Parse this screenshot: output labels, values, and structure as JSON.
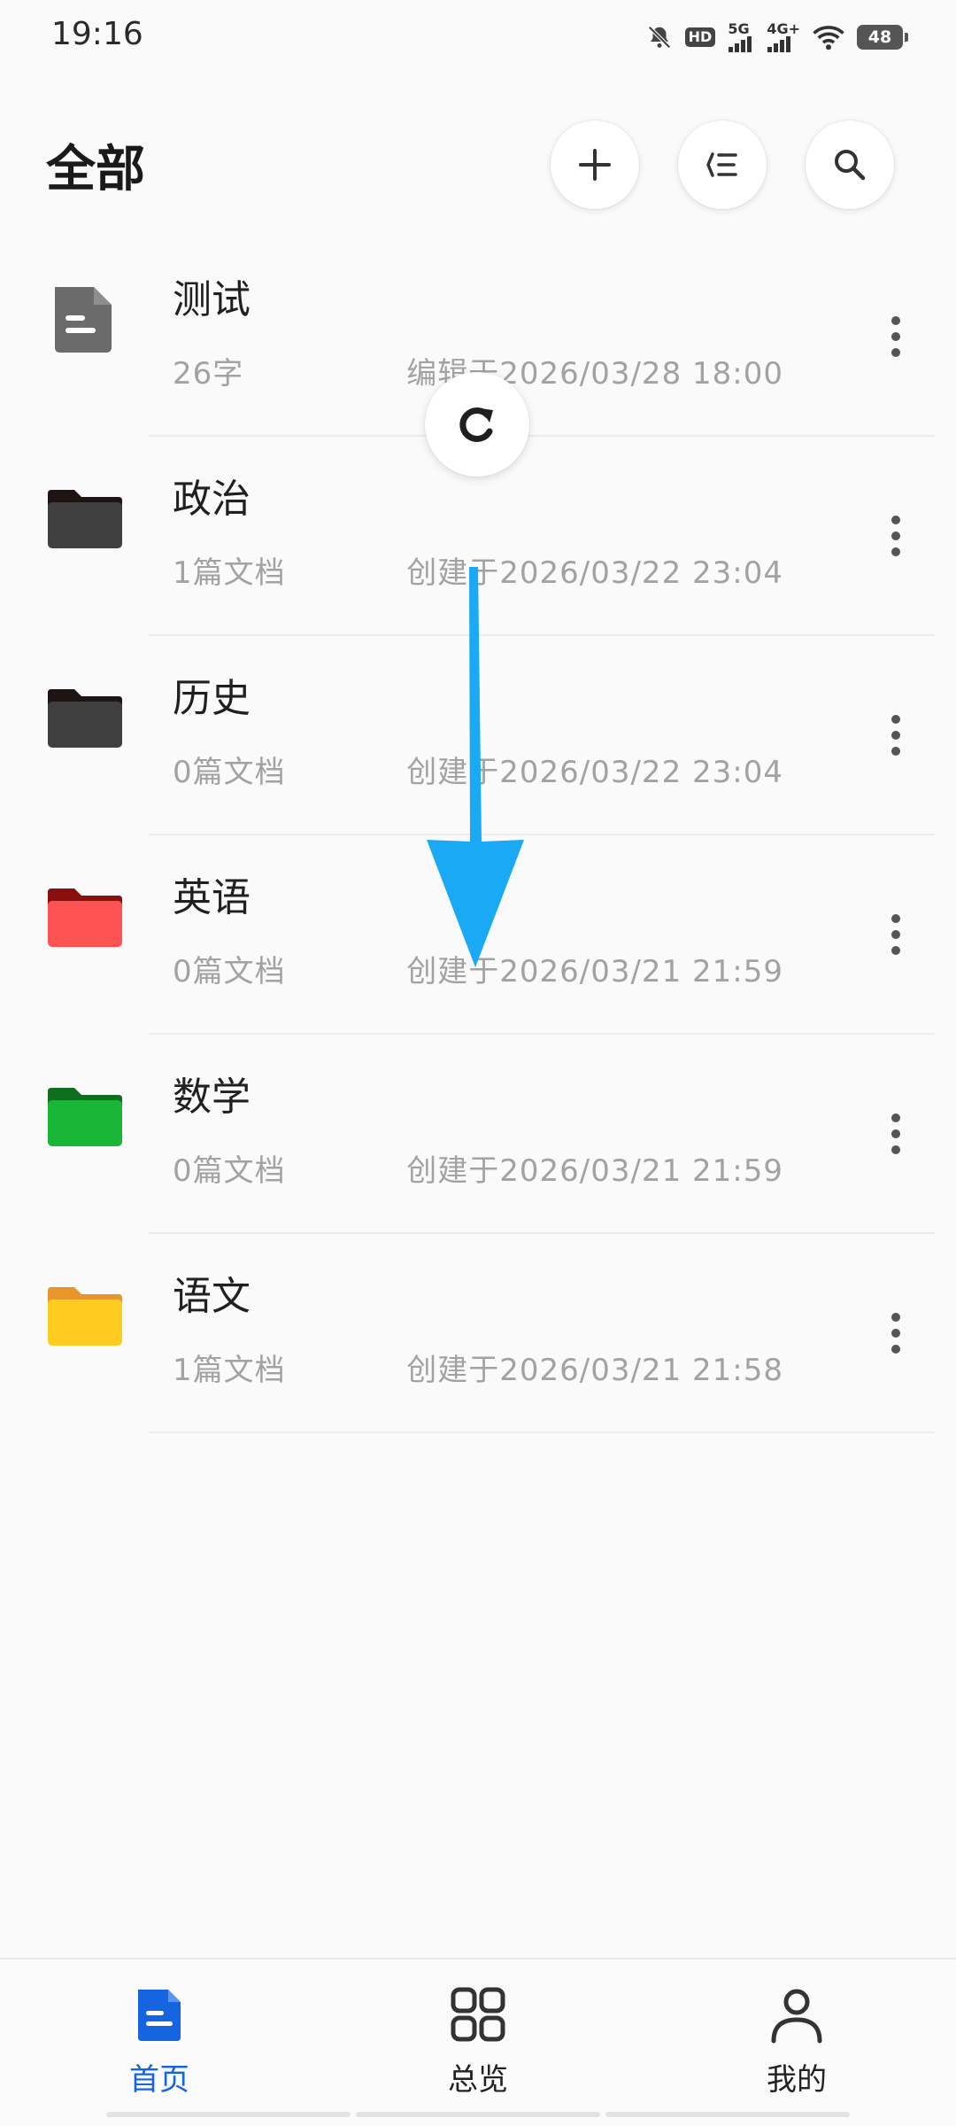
{
  "status_bar": {
    "time": "19:16",
    "icons": [
      "bell-off-icon",
      "hd-icon",
      "5g-signal-icon",
      "4g-signal-icon",
      "wifi-icon",
      "battery-icon"
    ],
    "net1": "5G",
    "net2": "4G+",
    "hd": "HD",
    "battery": "48"
  },
  "header": {
    "title": "全部",
    "buttons": [
      "add-icon",
      "list-icon",
      "search-icon"
    ]
  },
  "items": [
    {
      "name": "测试",
      "meta": "26字",
      "date": "编辑于2026/03/28 18:00",
      "type": "document",
      "color": "#6b6b6b"
    },
    {
      "name": "政治",
      "meta": "1篇文档",
      "date": "创建于2026/03/22 23:04",
      "type": "folder",
      "color": "#3f3f3f"
    },
    {
      "name": "历史",
      "meta": "0篇文档",
      "date": "创建于2026/03/22 23:04",
      "type": "folder",
      "color": "#3f3f3f"
    },
    {
      "name": "英语",
      "meta": "0篇文档",
      "date": "创建于2026/03/21 21:59",
      "type": "folder",
      "color": "#ff5252"
    },
    {
      "name": "数学",
      "meta": "0篇文档",
      "date": "创建于2026/03/21 21:59",
      "type": "folder",
      "color": "#18b536"
    },
    {
      "name": "语文",
      "meta": "1篇文档",
      "date": "创建于2026/03/21 21:58",
      "type": "folder",
      "color": "#ffcc1f"
    }
  ],
  "bottom_nav": {
    "items": [
      {
        "label": "首页",
        "icon": "home-document-icon",
        "active": true
      },
      {
        "label": "总览",
        "icon": "grid-icon",
        "active": false
      },
      {
        "label": "我的",
        "icon": "person-icon",
        "active": false
      }
    ]
  },
  "colors": {
    "accent": "#1565e0",
    "swipe_arrow": "#1aaaf5"
  }
}
